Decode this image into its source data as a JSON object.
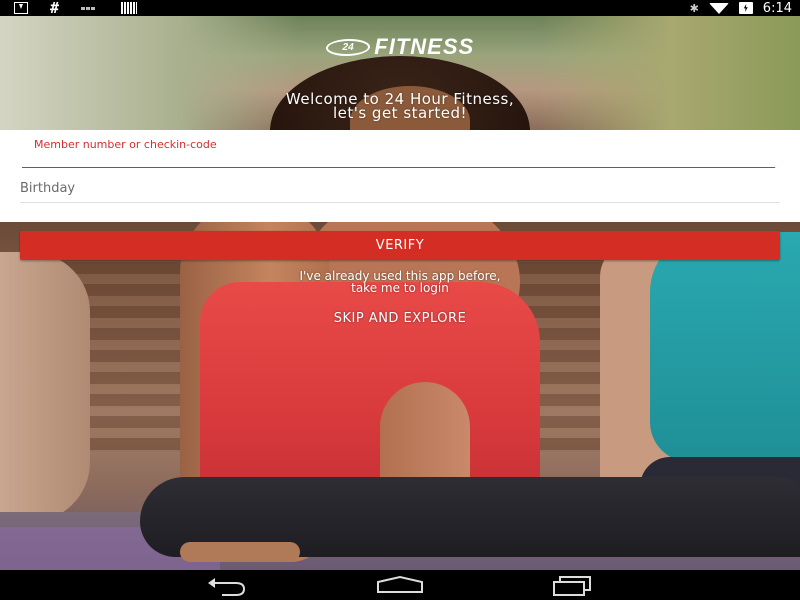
{
  "status_bar": {
    "time": "6:14",
    "left_icons": [
      "download-icon",
      "hash-icon",
      "voicemail-icon",
      "barcode-icon"
    ],
    "right_icons": [
      "bluetooth-icon",
      "wifi-icon",
      "battery-charging-icon"
    ]
  },
  "header": {
    "logo_badge": "24",
    "logo_text": "FITNESS",
    "welcome_line1": "Welcome to 24 Hour Fitness,",
    "welcome_line2": "let's get started!"
  },
  "form": {
    "member_label": "Member number or checkin-code",
    "member_value": "",
    "birthday_placeholder": "Birthday"
  },
  "actions": {
    "verify_label": "VERIFY",
    "login_line1": "I've already used this app before,",
    "login_line2": "take me to login",
    "skip_label": "SKIP AND EXPLORE"
  },
  "nav_bar": {
    "buttons": [
      "back-icon",
      "home-icon",
      "recents-icon"
    ]
  },
  "colors": {
    "accent": "#d42e24",
    "field_accent": "#d32f2f",
    "form_bg": "#ffffff",
    "bars_bg": "#000000"
  }
}
